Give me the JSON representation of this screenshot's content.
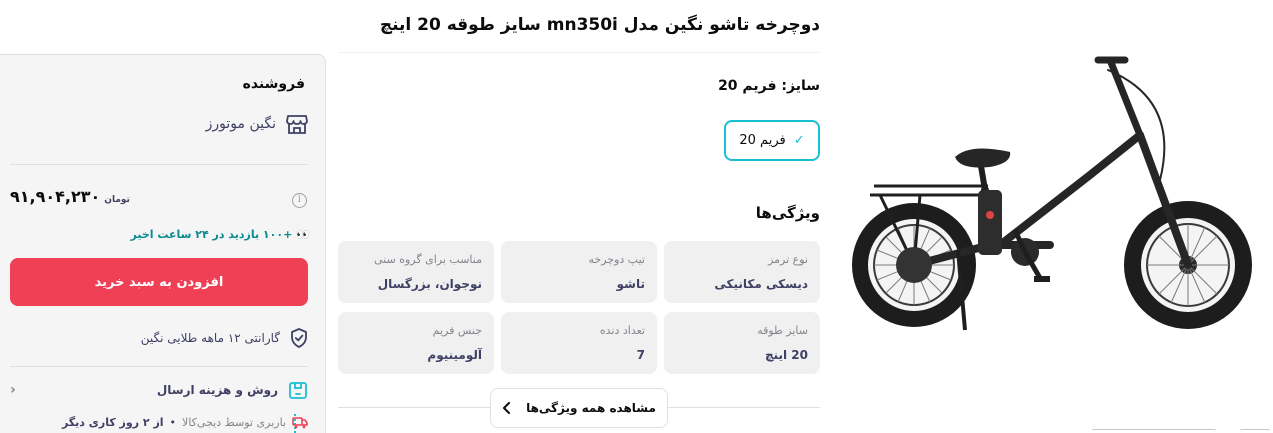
{
  "product": {
    "title": "دوچرخه تاشو نگین مدل mn350i سایز طوقه 20 اینچ"
  },
  "variant": {
    "label": "سایز: فریم 20",
    "selected": "فریم 20"
  },
  "features": {
    "title": "ویژگی‌ها",
    "items": [
      {
        "key": "نوع ترمز",
        "value": "دیسکی مکانیکی"
      },
      {
        "key": "تیپ دوچرخه",
        "value": "تاشو"
      },
      {
        "key": "مناسب برای گروه سنی",
        "value": "نوجوان، بزرگسال"
      },
      {
        "key": "سایز طوقه",
        "value": "20 اینچ"
      },
      {
        "key": "تعداد دنده",
        "value": "7"
      },
      {
        "key": "جنس فریم",
        "value": "آلومینیوم"
      }
    ],
    "show_all": "مشاهده همه ویژگی‌ها"
  },
  "buybox": {
    "seller_heading": "فروشنده",
    "seller_name": "نگین موتورز",
    "price": "۹۱,۹۰۴,۲۳۰",
    "currency": "تومان",
    "visits_emoji": "👀",
    "visits": "+۱۰۰ بازدید در ۲۴ ساعت اخیر",
    "add_to_cart": "افزودن به سبد خرید",
    "warranty": "گارانتی ۱۲ ماهه طلایی نگین",
    "shipping_title": "روش و هزینه ارسال",
    "shipping_line": "باربری توسط دیجی‌کالا",
    "shipping_eta": "از ۲ روز کاری دیگر"
  },
  "colors": {
    "accent": "#19bfd3",
    "cta": "#ef4056",
    "teal_text": "#088b90"
  }
}
